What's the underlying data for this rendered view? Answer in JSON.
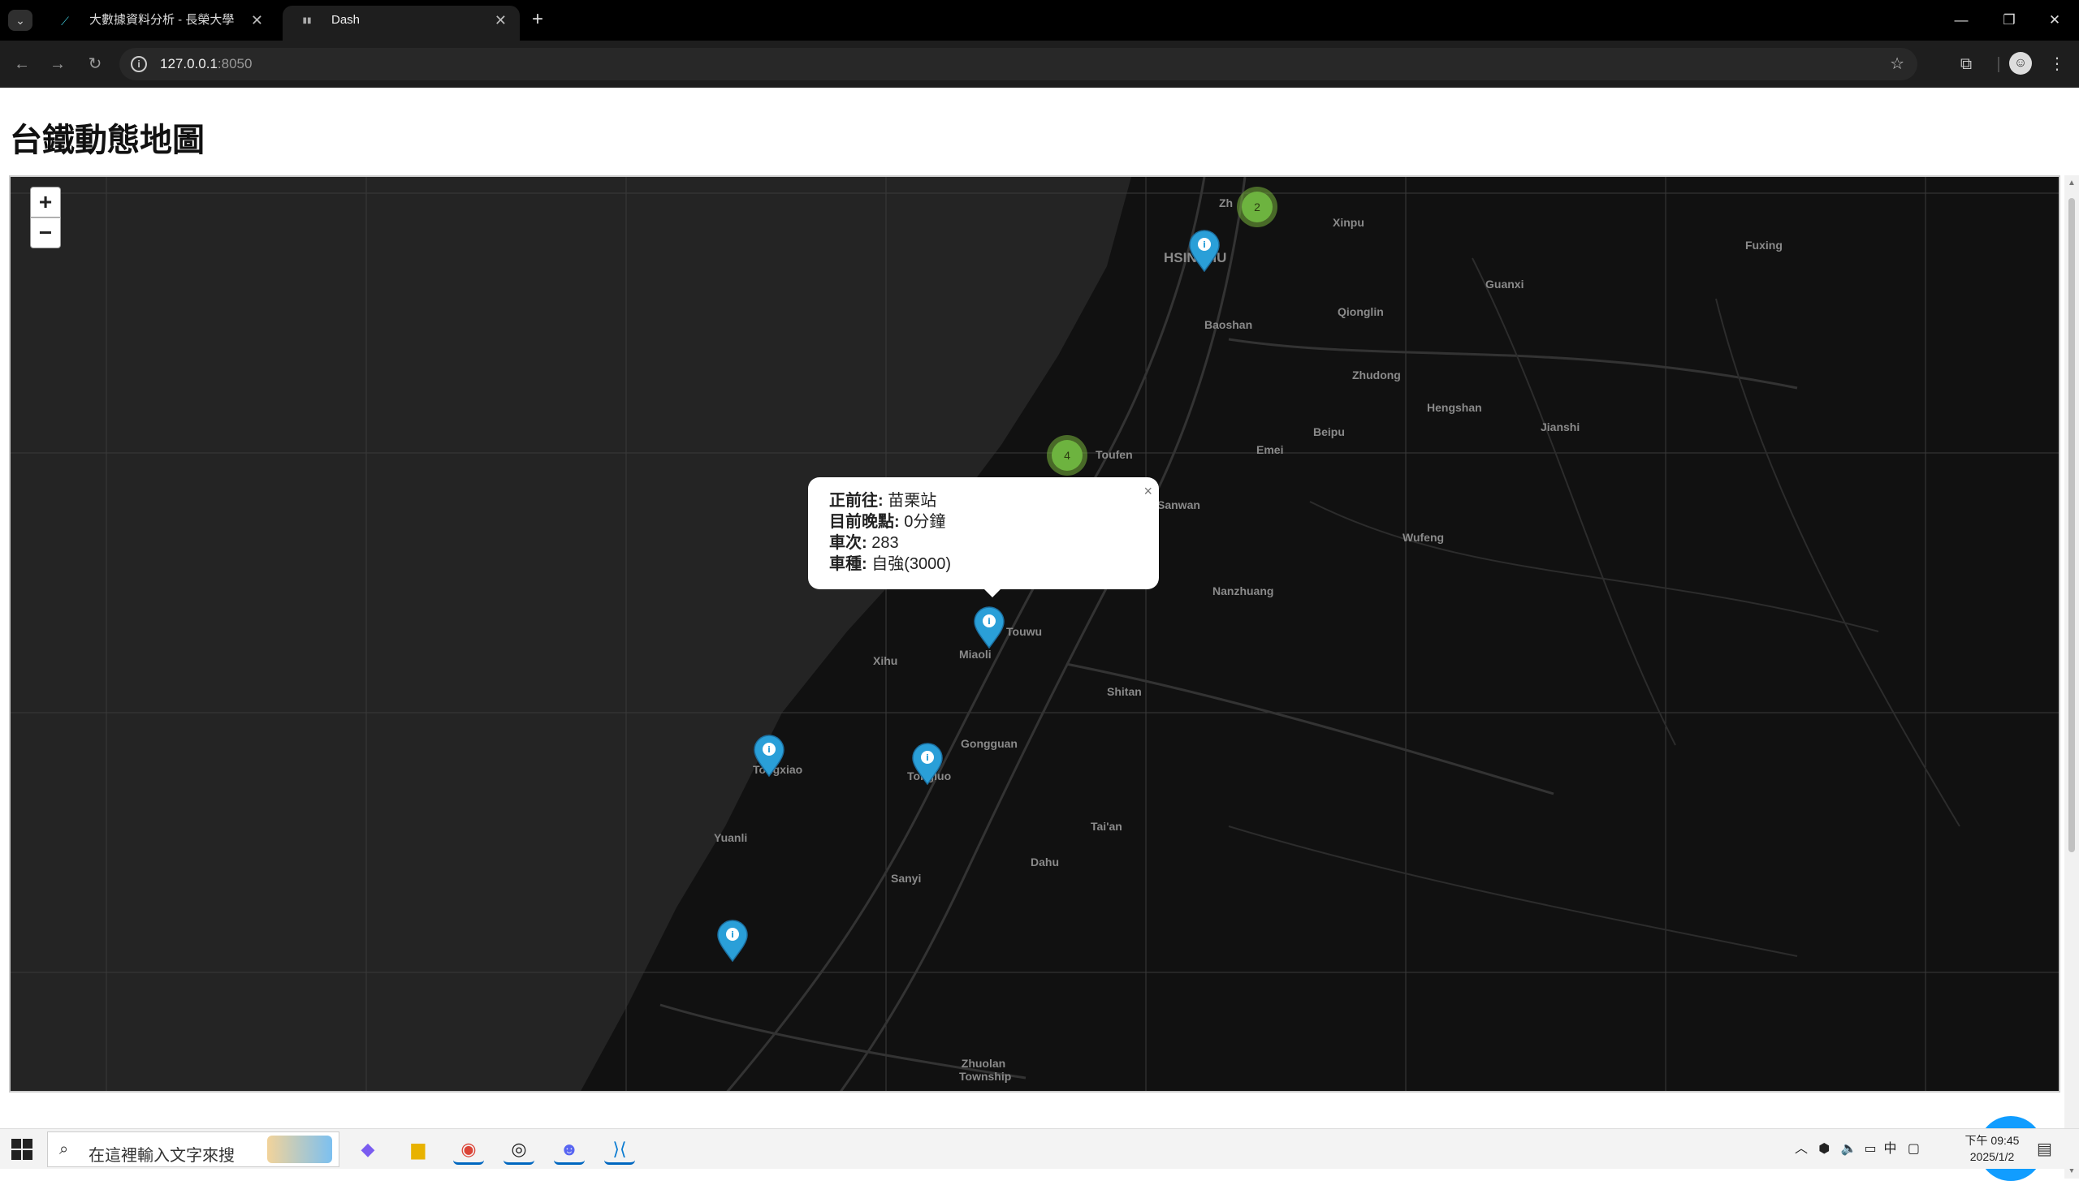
{
  "browser": {
    "tabs": [
      {
        "title": "大數據資料分析 - 長榮大學",
        "icon": "moodle-icon"
      },
      {
        "title": "Dash",
        "icon": "dash-icon"
      }
    ],
    "url_host": "127.0.0.1",
    "url_port": ":8050"
  },
  "page": {
    "title": "台鐵動態地圖"
  },
  "map": {
    "zoom_in": "+",
    "zoom_out": "−",
    "clusters": [
      {
        "count": "2"
      },
      {
        "count": "4"
      }
    ],
    "place_labels": [
      "Zh",
      "Xinpu",
      "HSINCHU",
      "Fuxing",
      "Guanxi",
      "Baoshan",
      "Qionglin",
      "Zhudong",
      "Hengshan",
      "Jianshi",
      "Beipu",
      "Toufen",
      "Emei",
      "Sanwan",
      "Wufeng",
      "Nanzhuang",
      "Touwu",
      "Miaoli",
      "Xihu",
      "Shitan",
      "Gongguan",
      "Tongxiao",
      "Tongluo",
      "Yuanli",
      "Tai'an",
      "Dahu",
      "Sanyi",
      "Zhuolan Township"
    ],
    "popup": {
      "label_destination": "正前往:",
      "value_destination": "苗栗站",
      "label_delay": "目前晚點:",
      "value_delay": "0分鐘",
      "label_train_no": "車次:",
      "value_train_no": "283",
      "label_train_type": "車種:",
      "value_train_type": "自強(3000)",
      "close": "×"
    }
  },
  "taskbar": {
    "search_placeholder": "在這裡輸入文字來搜",
    "ime": "中",
    "time": "下午 09:45",
    "date": "2025/1/2"
  },
  "colors": {
    "marker": "#2a9fd8",
    "cluster": "#6db33f",
    "fab": "#119dff",
    "map_bg": "#242424"
  }
}
